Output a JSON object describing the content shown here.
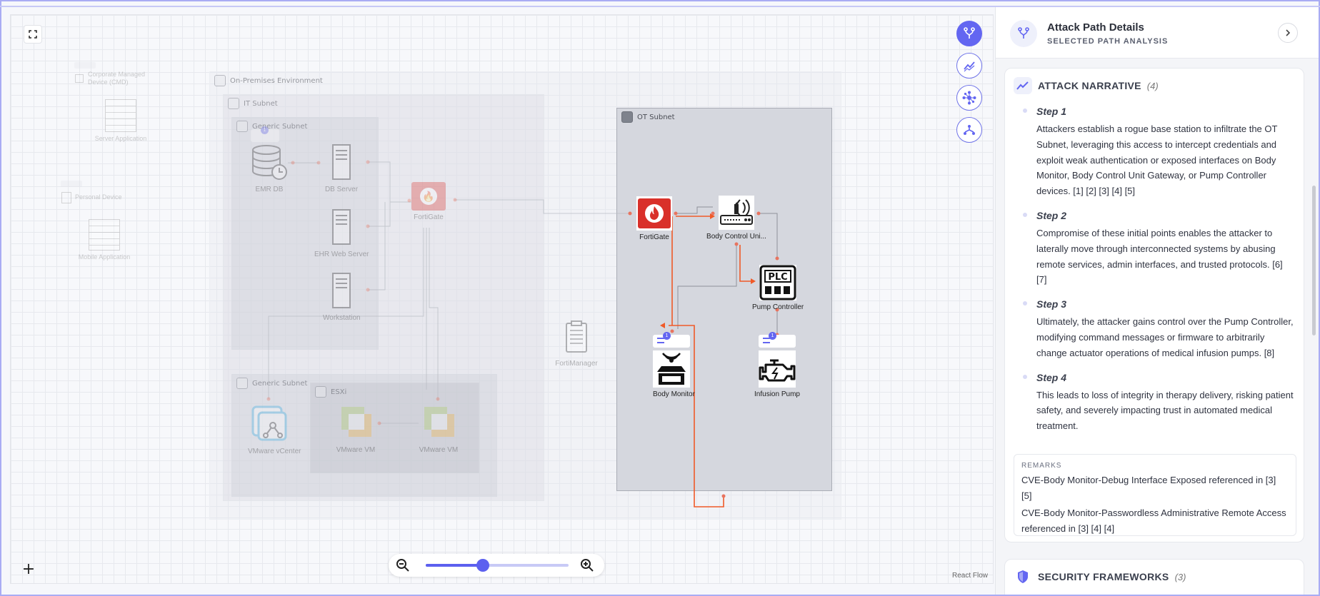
{
  "canvas": {
    "groups": {
      "on_premises": "On-Premises Environment",
      "it_subnet": "IT Subnet",
      "generic_subnet_1": "Generic Subnet",
      "generic_subnet_2": "Generic Subnet",
      "esxi": "ESXi",
      "ot_subnet": "OT Subnet"
    },
    "nodes": {
      "corp_managed": "Corporate Managed Device (CMD)",
      "server_app": "Server Application",
      "personal_device": "Personal Device",
      "mobile_app": "Mobile Application",
      "emr_db": "EMR DB",
      "db_server": "DB Server",
      "ehr_web_server": "EHR Web Server",
      "workstation": "Workstation",
      "fortigate_it": "FortiGate",
      "fortimanager": "FortiManager",
      "vcenter": "VMware vCenter",
      "vm1": "VMware VM",
      "vm2": "VMware VM",
      "fortigate_ot": "FortiGate",
      "body_control": "Body Control Uni...",
      "pump_controller": "Pump Controller",
      "body_monitor": "Body Monitor",
      "infusion_pump": "Infusion Pump"
    },
    "badges": {
      "emr_db": "1",
      "body_monitor": "1",
      "infusion_pump": "1"
    },
    "plc_text": "PLC",
    "add_symbol": "+",
    "watermark": "React Flow"
  },
  "zoom": {
    "level": 0.4
  },
  "panel": {
    "title": "Attack Path Details",
    "subtitle": "SELECTED PATH ANALYSIS",
    "close_icon": "chevron-right-icon",
    "narrative": {
      "title": "ATTACK NARRATIVE",
      "count": "(4)",
      "steps": [
        {
          "title": "Step 1",
          "text": "Attackers establish a rogue base station to infiltrate the OT Subnet, leveraging this access to intercept credentials and exploit weak authentication or exposed interfaces on Body Monitor, Body Control Unit Gateway, or Pump Controller devices. [1] [2] [3] [4] [5]"
        },
        {
          "title": "Step 2",
          "text": "Compromise of these initial points enables the attacker to laterally move through interconnected systems by abusing remote services, admin interfaces, and trusted protocols. [6] [7]"
        },
        {
          "title": "Step 3",
          "text": "Ultimately, the attacker gains control over the Pump Controller, modifying command messages or firmware to arbitrarily change actuator operations of medical infusion pumps. [8]"
        },
        {
          "title": "Step 4",
          "text": "This leads to loss of integrity in therapy delivery, risking patient safety, and severely impacting trust in automated medical treatment."
        }
      ],
      "remarks_title": "REMARKS",
      "remarks": [
        "CVE-Body Monitor-Debug Interface Exposed referenced in [3] [5]",
        "CVE-Body Monitor-Passwordless Administrative Remote Access referenced in [3] [4] [4]"
      ]
    },
    "frameworks": {
      "title": "SECURITY FRAMEWORKS",
      "count": "(3)"
    }
  },
  "colors": {
    "accent": "#6366f1",
    "attack_path": "#f05a28",
    "fortigate": "#d9302a"
  }
}
